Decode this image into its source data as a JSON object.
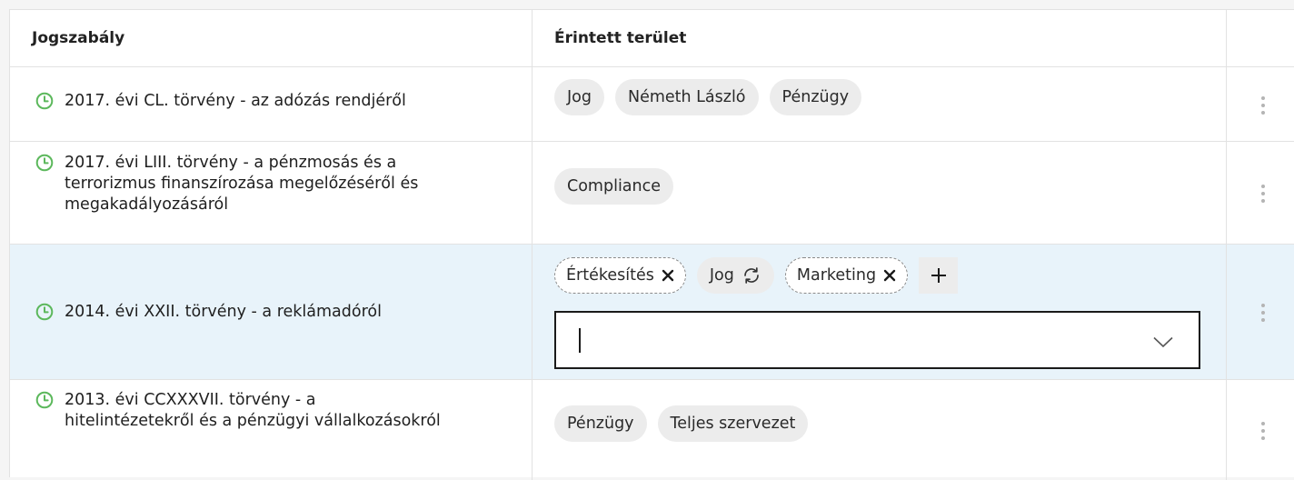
{
  "header": {
    "law_column": "Jogszabály",
    "area_column": "Érintett terület"
  },
  "colors": {
    "clock_icon": "#5cb85c",
    "active_row": "#e8f3fa",
    "tag_background": "#ececec"
  },
  "rows": [
    {
      "law": "2017. évi CL. törvény - az adózás rendjéről",
      "tags": [
        "Jog",
        "Németh László",
        "Pénzügy"
      ]
    },
    {
      "law": "2017. évi LIII. törvény - a pénzmosás és a terrorizmus finanszírozása megelőzéséről és megakadályozásáról",
      "tags": [
        "Compliance"
      ]
    },
    {
      "law": "2014. évi XXII. törvény - a reklámadóról",
      "editing": true,
      "tags": [
        {
          "label": "Értékesítés",
          "action": "remove-icon"
        },
        {
          "label": "Jog",
          "action": "restore-icon"
        },
        {
          "label": "Marketing",
          "action": "remove-icon"
        }
      ],
      "input": {
        "value": "",
        "placeholder": ""
      }
    },
    {
      "law": "2013. évi CCXXXVII. törvény - a hitelintézetekről és a pénzügyi vállalkozásokról",
      "tags": [
        "Pénzügy",
        "Teljes szervezet"
      ]
    }
  ]
}
